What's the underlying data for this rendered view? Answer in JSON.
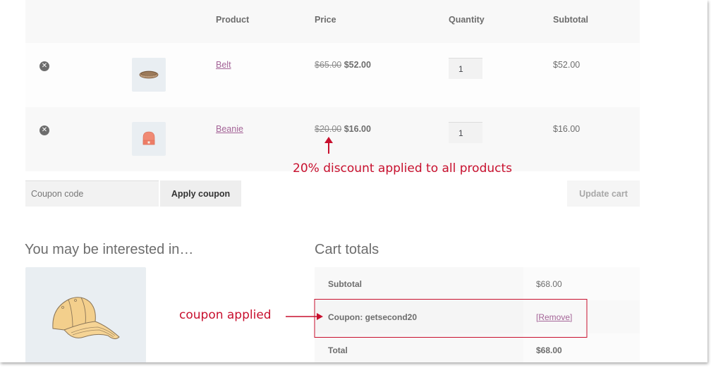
{
  "cart": {
    "headers": {
      "product": "Product",
      "price": "Price",
      "quantity": "Quantity",
      "subtotal": "Subtotal"
    },
    "items": [
      {
        "name": "Belt",
        "thumbnail_icon": "belt-image",
        "regular_price": "$65.00",
        "sale_price": "$52.00",
        "quantity": "1",
        "subtotal": "$52.00",
        "remove_icon": "remove-circle-x-icon"
      },
      {
        "name": "Beanie",
        "thumbnail_icon": "beanie-image",
        "regular_price": "$20.00",
        "sale_price": "$16.00",
        "quantity": "1",
        "subtotal": "$16.00",
        "remove_icon": "remove-circle-x-icon"
      }
    ]
  },
  "actions": {
    "coupon_placeholder": "Coupon code",
    "coupon_value": "",
    "apply_coupon_label": "Apply coupon",
    "update_cart_label": "Update cart"
  },
  "cross_sells": {
    "title": "You may be interested in…",
    "product_image_icon": "baseball-cap-image"
  },
  "totals": {
    "title": "Cart totals",
    "rows": [
      {
        "label": "Subtotal",
        "value": "$68.00"
      },
      {
        "label": "Coupon: getsecond20",
        "value_prefix": "[",
        "value": "Remove",
        "value_suffix": "]"
      },
      {
        "label": "Total",
        "value": "$68.00"
      }
    ]
  },
  "annotations": {
    "discount_note": "20% discount applied to all products",
    "coupon_note": "coupon applied",
    "color": "#c8102e"
  },
  "colors": {
    "link": "#a46497",
    "text": "#6d6d6d",
    "annotation": "#c8102e"
  }
}
